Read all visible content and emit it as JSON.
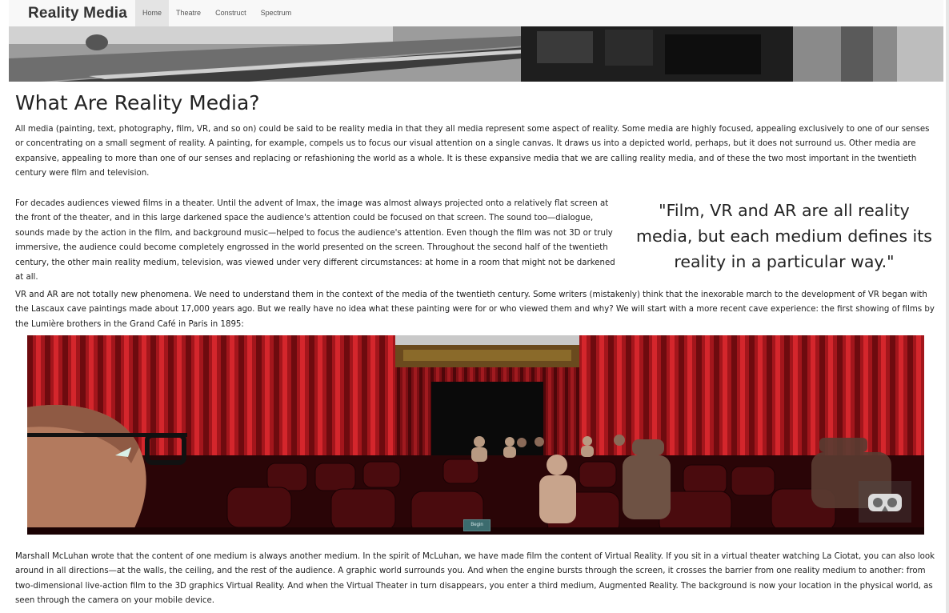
{
  "navbar": {
    "brand": "Reality Media",
    "items": [
      {
        "label": "Home",
        "active": true
      },
      {
        "label": "Theatre",
        "active": false
      },
      {
        "label": "Construct",
        "active": false
      },
      {
        "label": "Spectrum",
        "active": false
      }
    ]
  },
  "main": {
    "title": "What Are Reality Media?",
    "paragraph1": "All media (painting, text, photography, film, VR, and so on) could be said to be reality media in that they all media represent some aspect of reality. Some media are highly focused, appealing exclusively to one of our senses or concentrating on a small segment of reality. A painting, for example, compels us to focus our visual attention on a single canvas. It draws us into a depicted world, perhaps, but it does not surround us. Other media are expansive, appealing to more than one of our senses and replacing or refashioning the world as a whole. It is these expansive media that we are calling reality media, and of these the two most important in the twentieth century were film and television.",
    "paragraph2": "For decades audiences viewed films in a theater. Until the advent of Imax, the image was almost always projected onto a relatively flat screen at the front of the theater, and in this large darkened space the audience's attention could be focused on that screen. The sound too—dialogue, sounds made by the action in the film, and background music—helped to focus the audience's attention. Even though the film was not 3D or truly immersive, the audience could become completely engrossed in the world presented on the screen. Throughout the second half of the twentieth century, the other main reality medium, television, was viewed under very different circumstances: at home in a room that might not be darkened at all.",
    "quote": "\"Film, VR and AR are all reality media, but each medium defines its reality in a particular way.\"",
    "paragraph3": "VR and AR are not totally new phenomena. We need to understand them in the context of the media of the twentieth century. Some writers (mistakenly) think that the inexorable march to the development of VR began with the Lascaux cave paintings made about 17,000 years ago. But we really have no idea what these painting were for or who viewed them and why? We will start with a more recent cave experience: the first showing of films by the Lumière brothers in the Grand Café in Paris in 1895:",
    "paragraph4": "Marshall McLuhan wrote that the content of one medium is always another medium. In the spirit of McLuhan, we have made film the content of Virtual Reality. If you sit in a virtual theater watching La Ciotat, you can also look around in all directions—at the walls, the ceiling, and the rest of the audience. A graphic world surrounds you. And when the engine bursts through the screen, it crosses the barrier from one reality medium to another: from two-dimensional live-action film to the 3D graphics Virtual Reality. And when the Virtual Theater in turn disappears, you enter a third medium, Augmented Reality. The background is now your location in the physical world, as seen through the camera on your mobile device."
  },
  "scene": {
    "begin_label": "Begin",
    "vr_icon": "vr-goggles-icon"
  },
  "colors": {
    "curtain": "#a3161c",
    "seat": "#5a0d10",
    "nav_bg": "#f8f8f8"
  }
}
